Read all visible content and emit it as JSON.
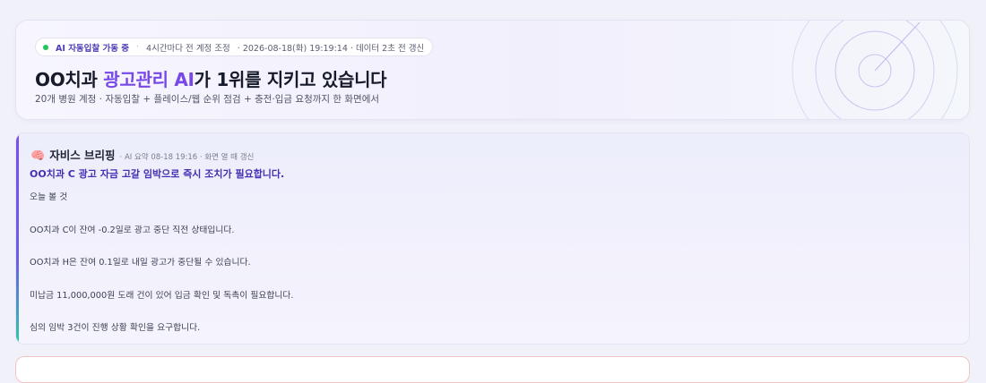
{
  "hero": {
    "status_live": "AI 자동입찰 가동 중",
    "status_sep": "·",
    "status_cycle": "4시간마다 전 계정 조정",
    "status_time": "· 2026-08-18(화) 19:19:14 · 데이터 2초 전 갱신",
    "title_prefix": "OO치과 ",
    "title_accent": "광고관리 AI",
    "title_suffix": "가 1위를 지키고 있습니다",
    "subtitle": "20개 병원 계정 · 자동입찰 + 플레이스/웹 순위 점검 + 충전·입금 요청까지 한 화면에서"
  },
  "briefing": {
    "icon": "brain-icon",
    "title": "자비스 브리핑",
    "meta": "· AI 요약 08-18 19:16 · 화면 열 때 갱신",
    "headline": "OO치과 C 광고 자금 고갈 임박으로 즉시 조치가 필요합니다.",
    "lines": [
      "오늘 볼 것",
      "OO치과 C이 잔여 -0.2일로 광고 중단 직전 상태입니다.",
      "OO치과 H은 잔여 0.1일로 내일 광고가 중단될 수 있습니다.",
      "미납금 11,000,000원 도래 건이 있어 입금 확인 및 독촉이 필요합니다.",
      "심의 임박 3건이 진행 상황 확인을 요구합니다."
    ]
  },
  "colors": {
    "accent": "#7748e6",
    "headline": "#4330b5",
    "live": "#22c55e",
    "alert_border": "#f2c4c4"
  }
}
